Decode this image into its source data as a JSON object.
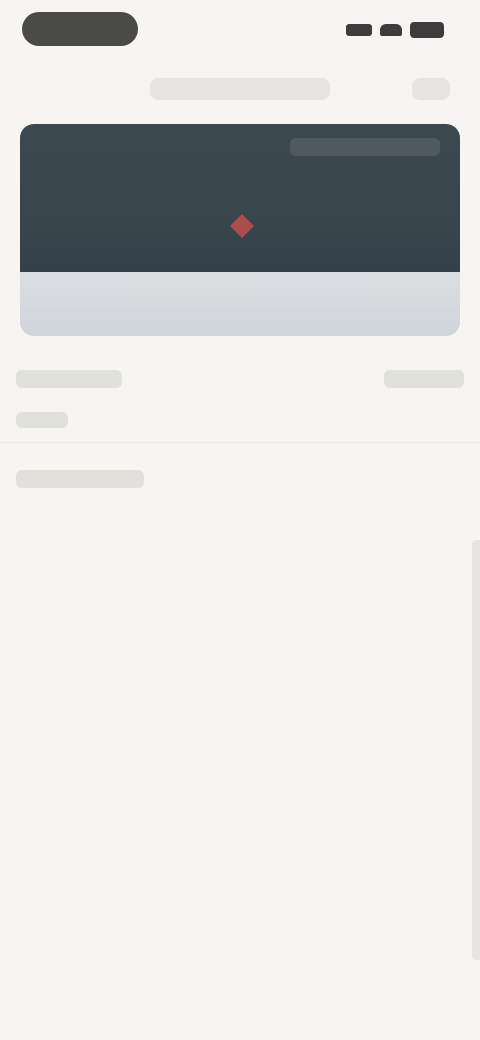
{
  "status_bar": {
    "icons": [
      "signal-icon",
      "wifi-icon",
      "battery-icon"
    ]
  },
  "header": {
    "title": ""
  },
  "video": {
    "marker_icon": "play-marker-icon",
    "accent_color": "#c0504d"
  },
  "colors": {
    "background": "#f6f5f1",
    "video_frame": "#3a464e",
    "status_pill": "#4a4a48"
  }
}
